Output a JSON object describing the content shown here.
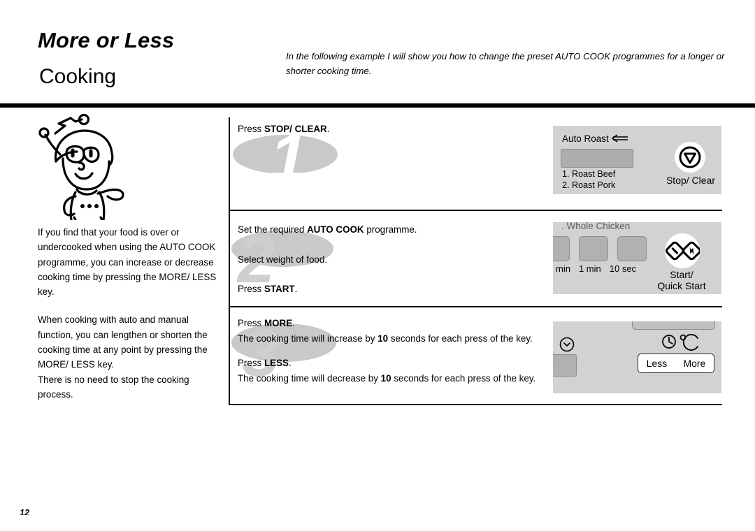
{
  "header": {
    "title": "More or Less",
    "subtitle": "Cooking",
    "intro": "In the following example I will show you how to change the preset AUTO COOK programmes for a longer or shorter cooking time."
  },
  "left_column": {
    "paragraph_1": "If you find that your food is over or undercooked when using the AUTO COOK programme, you can increase or decrease cooking time by pressing the MORE/ LESS key.",
    "paragraph_2": "When cooking with auto and manual function, you can lengthen or shorten the cooking time at any  point by pressing the MORE/ LESS key.",
    "paragraph_3": "There is no need to stop the cooking process."
  },
  "steps": [
    {
      "number": "1",
      "lines": [
        {
          "prefix": "Press ",
          "bold": "STOP/ CLEAR",
          "suffix": "."
        }
      ]
    },
    {
      "number": "2",
      "lines": [
        {
          "prefix": "Set the required ",
          "bold": "AUTO COOK",
          "suffix": " programme."
        },
        {
          "prefix": "Select weight of food.",
          "bold": "",
          "suffix": ""
        },
        {
          "prefix": "Press ",
          "bold": "START",
          "suffix": "."
        }
      ]
    },
    {
      "number": "3",
      "lines": [
        {
          "prefix": "Press ",
          "bold": "MORE",
          "suffix": "."
        },
        {
          "prefix": "The cooking time will increase by ",
          "bold": "10",
          "suffix": " seconds for each press of the key."
        },
        {
          "prefix": "Press ",
          "bold": "LESS",
          "suffix": "."
        },
        {
          "prefix": "The cooking time will decrease by ",
          "bold": "10",
          "suffix": " seconds for each press of the key."
        }
      ]
    }
  ],
  "panels": {
    "panel_1": {
      "title": "Auto Roast",
      "title_icon": "left-arrow-icon",
      "menu_item_1": "1. Roast Beef",
      "menu_item_2": "2. Roast Pork",
      "round_button": {
        "caption": "Stop/ Clear",
        "icon": "stop-triangle-icon"
      }
    },
    "panel_2": {
      "clipped_title": ". Whole Chicken",
      "key_labels": [
        "min",
        "1 min",
        "10 sec"
      ],
      "round_button": {
        "caption_line_1": "Start/",
        "caption_line_2": "Quick Start",
        "icon": "start-quick-start-icon"
      }
    },
    "panel_3": {
      "clock_icon": "clock-icon",
      "temp_label": "°C",
      "less_label": "Less",
      "more_label": "More"
    }
  },
  "footer": {
    "page_number": "12"
  },
  "colors": {
    "panel_background": "#d2d2d2",
    "key_face": "#b1b1b1",
    "watermark": "#cfcfcf",
    "rule": "#000000"
  }
}
